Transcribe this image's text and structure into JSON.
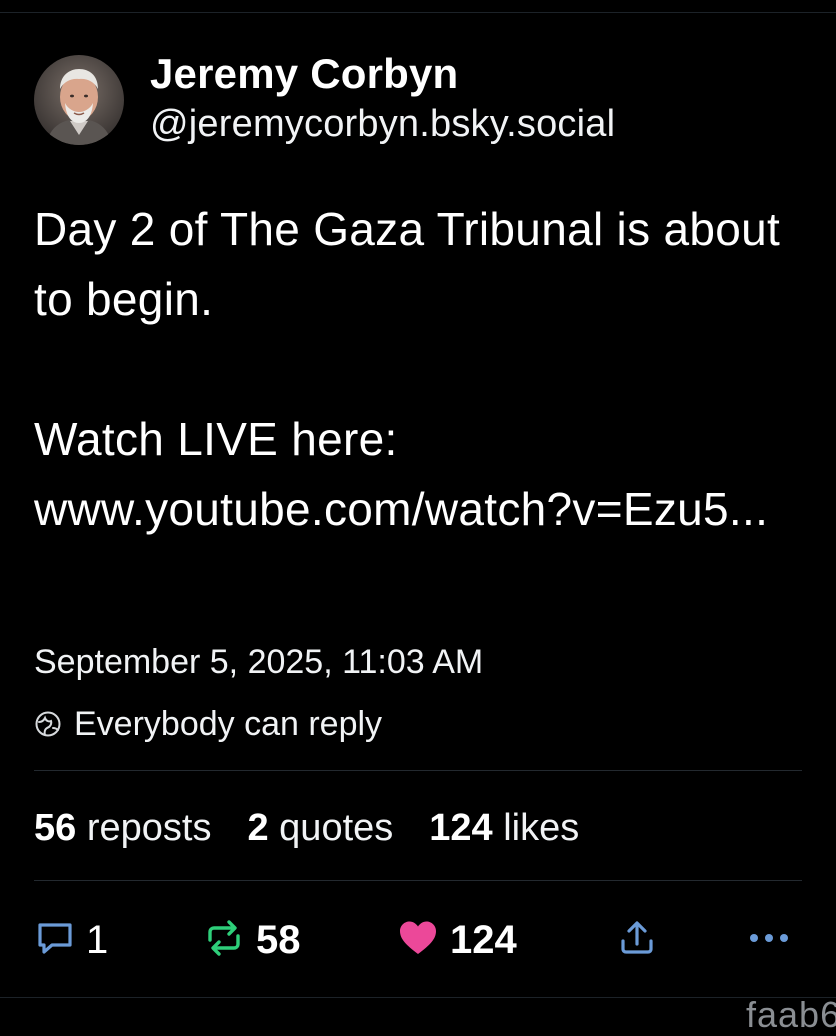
{
  "author": {
    "display_name": "Jeremy Corbyn",
    "handle": "@jeremycorbyn.bsky.social"
  },
  "post": {
    "line1": "Day 2 of The Gaza Tribunal is about to begin.",
    "line2": "Watch LIVE here:",
    "link_text": "www.youtube.com/watch?v=Ezu5..."
  },
  "meta": {
    "timestamp": "September 5, 2025, 11:03 AM",
    "reply_setting": "Everybody can reply"
  },
  "stats": {
    "reposts_count": "56",
    "reposts_label": "reposts",
    "quotes_count": "2",
    "quotes_label": "quotes",
    "likes_count": "124",
    "likes_label": "likes"
  },
  "actions": {
    "reply_count": "1",
    "repost_count": "58",
    "like_count": "124"
  },
  "watermark": "faab6",
  "colors": {
    "background": "#000000",
    "text": "#ffffff",
    "repost_green": "#2ecf7a",
    "like_pink": "#ec4899",
    "reply_blue": "#6b9bd8",
    "share_blue": "#6b9bd8",
    "divider": "#23292f"
  },
  "icons": {
    "reply": "speech-bubble-icon",
    "repost": "repost-arrows-icon",
    "like": "heart-icon",
    "share": "upload-icon",
    "more": "ellipsis-icon",
    "reply_setting": "globe-icon"
  }
}
